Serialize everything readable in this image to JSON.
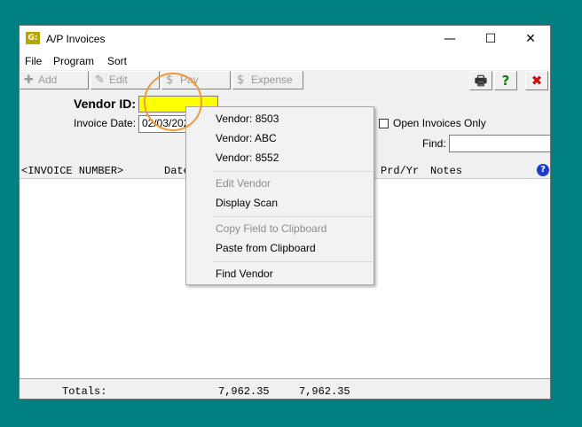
{
  "window": {
    "title": "A/P Invoices",
    "app_icon": "G:",
    "minimize": "—",
    "maximize": "☐",
    "close": "✕"
  },
  "menu": [
    "File",
    "Program",
    "Sort"
  ],
  "toolbar": {
    "add": {
      "label": "Add",
      "icon": "add-icon",
      "glyph": "✚"
    },
    "edit": {
      "label": "Edit",
      "icon": "pencil-icon",
      "glyph": "✎"
    },
    "pay": {
      "label": "Pay",
      "icon": "money-icon",
      "glyph": "$"
    },
    "expense": {
      "label": "Expense",
      "icon": "money-icon",
      "glyph": "$"
    },
    "print": {
      "icon": "printer-icon",
      "glyph": "🖶"
    },
    "help": {
      "icon": "help-icon",
      "glyph": "?"
    },
    "exit": {
      "icon": "close-icon",
      "glyph": "✖"
    }
  },
  "form": {
    "vendor_label": "Vendor ID:",
    "vendor_value": "",
    "invoice_date_label": "Invoice Date:",
    "invoice_date_value": "02/03/202",
    "open_only_label": "Open Invoices Only",
    "find_label": "Find:",
    "find_value": ""
  },
  "columns": {
    "invoice_number": "<INVOICE NUMBER>",
    "date": "Date",
    "prd_yr": "Prd/Yr",
    "notes": "Notes",
    "help_glyph": "?"
  },
  "totals": {
    "label": "Totals:",
    "amount1": "7,962.35",
    "amount2": "7,962.35"
  },
  "context_menu": [
    {
      "label": "Vendor: 8503",
      "enabled": true
    },
    {
      "label": "Vendor: ABC",
      "enabled": true
    },
    {
      "label": "Vendor: 8552",
      "enabled": true
    },
    {
      "label": "Edit Vendor",
      "enabled": false
    },
    {
      "label": "Display Scan",
      "enabled": true
    },
    {
      "label": "Copy Field to Clipboard",
      "enabled": false
    },
    {
      "label": "Paste from Clipboard",
      "enabled": true
    },
    {
      "label": "Find Vendor",
      "enabled": true
    }
  ],
  "colors": {
    "desktop": "#008080",
    "vendor_field": "#ffff00",
    "highlight_ring": "#f09a38",
    "exit_red": "#cc1010",
    "help_green": "#108010"
  }
}
